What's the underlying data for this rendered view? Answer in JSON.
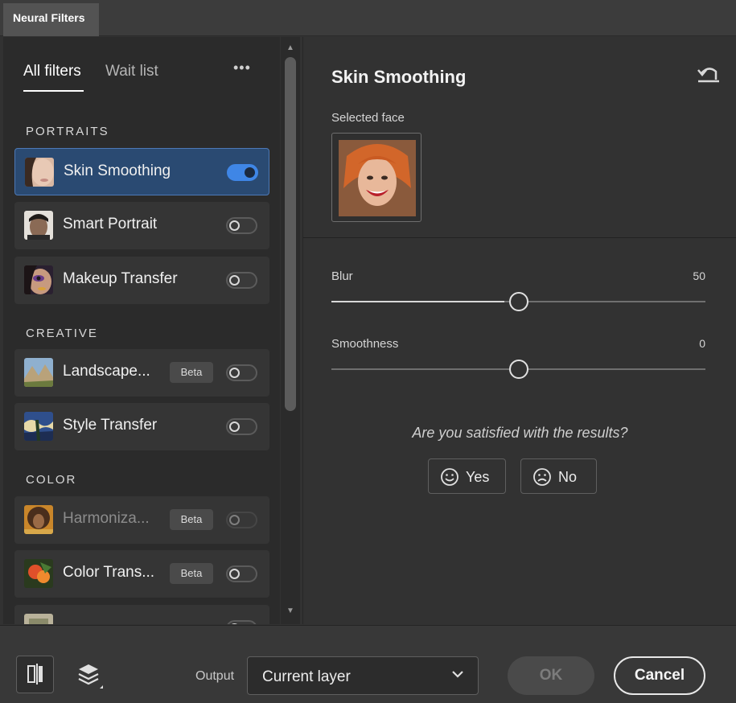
{
  "window": {
    "title": "Neural Filters"
  },
  "sidebar": {
    "tabs": [
      {
        "label": "All filters",
        "active": true
      },
      {
        "label": "Wait list",
        "active": false
      }
    ],
    "more_icon": "more-horizontal-icon",
    "more_label": "•••",
    "sections": [
      {
        "title": "PORTRAITS",
        "items": [
          {
            "label": "Skin Smoothing",
            "enabled": true,
            "selected": true,
            "thumb": "skin-thumb"
          },
          {
            "label": "Smart Portrait",
            "enabled": false,
            "thumb": "portrait-thumb"
          },
          {
            "label": "Makeup Transfer",
            "enabled": false,
            "thumb": "makeup-thumb"
          }
        ]
      },
      {
        "title": "CREATIVE",
        "items": [
          {
            "label": "Landscape...",
            "badge": "Beta",
            "enabled": false,
            "thumb": "landscape-thumb"
          },
          {
            "label": "Style Transfer",
            "enabled": false,
            "thumb": "style-thumb"
          }
        ]
      },
      {
        "title": "COLOR",
        "items": [
          {
            "label": "Harmoniza...",
            "badge": "Beta",
            "enabled": false,
            "dimmed": true,
            "thumb": "harmonize-thumb"
          },
          {
            "label": "Color Trans...",
            "badge": "Beta",
            "enabled": false,
            "thumb": "colortransfer-thumb"
          }
        ]
      }
    ]
  },
  "panel": {
    "title": "Skin Smoothing",
    "reset_icon": "undo-icon",
    "selected_face_label": "Selected face",
    "sliders": [
      {
        "label": "Blur",
        "value": "50",
        "fraction": 0.5
      },
      {
        "label": "Smoothness",
        "value": "0",
        "fraction": 0.5
      }
    ],
    "feedback": {
      "question": "Are you satisfied with the results?",
      "yes_label": "Yes",
      "no_label": "No"
    }
  },
  "footer": {
    "compare_icon": "split-compare-icon",
    "layers_icon": "layers-icon",
    "output_label": "Output",
    "output_value": "Current layer",
    "ok_label": "OK",
    "cancel_label": "Cancel"
  },
  "colors": {
    "accent": "#3f86e6",
    "selected_bg": "#2a4a72",
    "panel_bg": "#323232",
    "sidebar_bg": "#2b2b2b"
  }
}
